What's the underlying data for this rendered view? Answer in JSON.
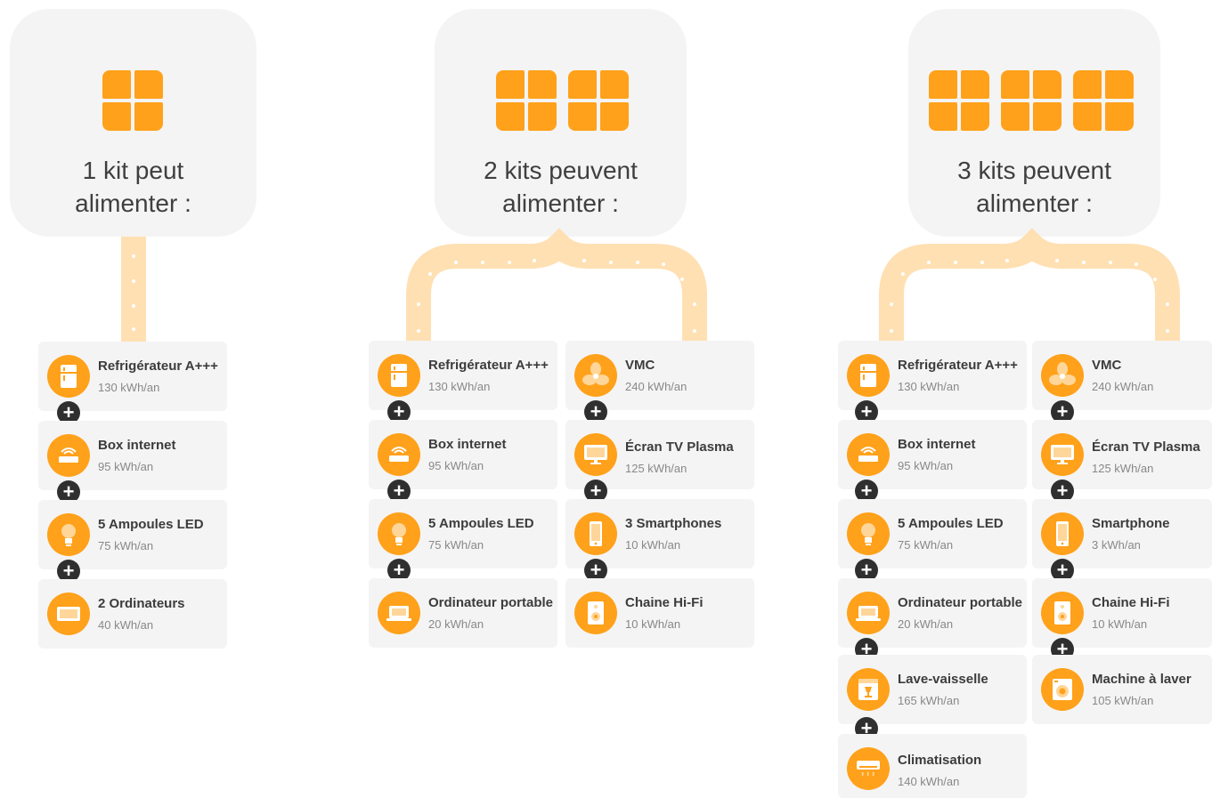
{
  "colors": {
    "accent": "#ffa11a",
    "card_bg": "#f4f4f4",
    "plus_bg": "#2f2f2f",
    "flow": "#ffe0b3"
  },
  "kits": [
    {
      "title_line1": "1 kit peut",
      "title_line2": "alimenter :",
      "left": [
        {
          "name": "Refrigérateur A+++",
          "energy": "130 kWh/an",
          "icon": "fridge-icon"
        },
        {
          "name": "Box internet",
          "energy": "95 kWh/an",
          "icon": "router-icon"
        },
        {
          "name": "5 Ampoules LED",
          "energy": "75 kWh/an",
          "icon": "bulb-icon"
        },
        {
          "name": "2 Ordinateurs",
          "energy": "40 kWh/an",
          "icon": "monitor-icon"
        }
      ]
    },
    {
      "title_line1": "2 kits peuvent",
      "title_line2": "alimenter :",
      "left": [
        {
          "name": "Refrigérateur A+++",
          "energy": "130 kWh/an",
          "icon": "fridge-icon"
        },
        {
          "name": "Box internet",
          "energy": "95 kWh/an",
          "icon": "router-icon"
        },
        {
          "name": "5 Ampoules LED",
          "energy": "75 kWh/an",
          "icon": "bulb-icon"
        },
        {
          "name": "Ordinateur portable",
          "energy": "20 kWh/an",
          "icon": "laptop-icon"
        }
      ],
      "right": [
        {
          "name": "VMC",
          "energy": "240 kWh/an",
          "icon": "fan-icon"
        },
        {
          "name": "Écran TV Plasma",
          "energy": "125 kWh/an",
          "icon": "tv-icon"
        },
        {
          "name": "3 Smartphones",
          "energy": "10 kWh/an",
          "icon": "smartphone-icon"
        },
        {
          "name": "Chaine Hi-Fi",
          "energy": "10 kWh/an",
          "icon": "speaker-icon"
        }
      ]
    },
    {
      "title_line1": "3 kits peuvent",
      "title_line2": "alimenter :",
      "left": [
        {
          "name": "Refrigérateur A+++",
          "energy": "130 kWh/an",
          "icon": "fridge-icon"
        },
        {
          "name": "Box internet",
          "energy": "95 kWh/an",
          "icon": "router-icon"
        },
        {
          "name": "5 Ampoules LED",
          "energy": "75 kWh/an",
          "icon": "bulb-icon"
        },
        {
          "name": "Ordinateur portable",
          "energy": "20 kWh/an",
          "icon": "laptop-icon"
        },
        {
          "name": "Lave-vaisselle",
          "energy": "165 kWh/an",
          "icon": "dishwasher-icon"
        },
        {
          "name": "Climatisation",
          "energy": "140 kWh/an",
          "icon": "air-conditioner-icon"
        }
      ],
      "right": [
        {
          "name": "VMC",
          "energy": "240 kWh/an",
          "icon": "fan-icon"
        },
        {
          "name": "Écran TV Plasma",
          "energy": "125 kWh/an",
          "icon": "tv-icon"
        },
        {
          "name": "Smartphone",
          "energy": "3 kWh/an",
          "icon": "smartphone-icon"
        },
        {
          "name": "Chaine Hi-Fi",
          "energy": "10 kWh/an",
          "icon": "speaker-icon"
        },
        {
          "name": "Machine à laver",
          "energy": "105 kWh/an",
          "icon": "washing-machine-icon"
        }
      ]
    }
  ]
}
